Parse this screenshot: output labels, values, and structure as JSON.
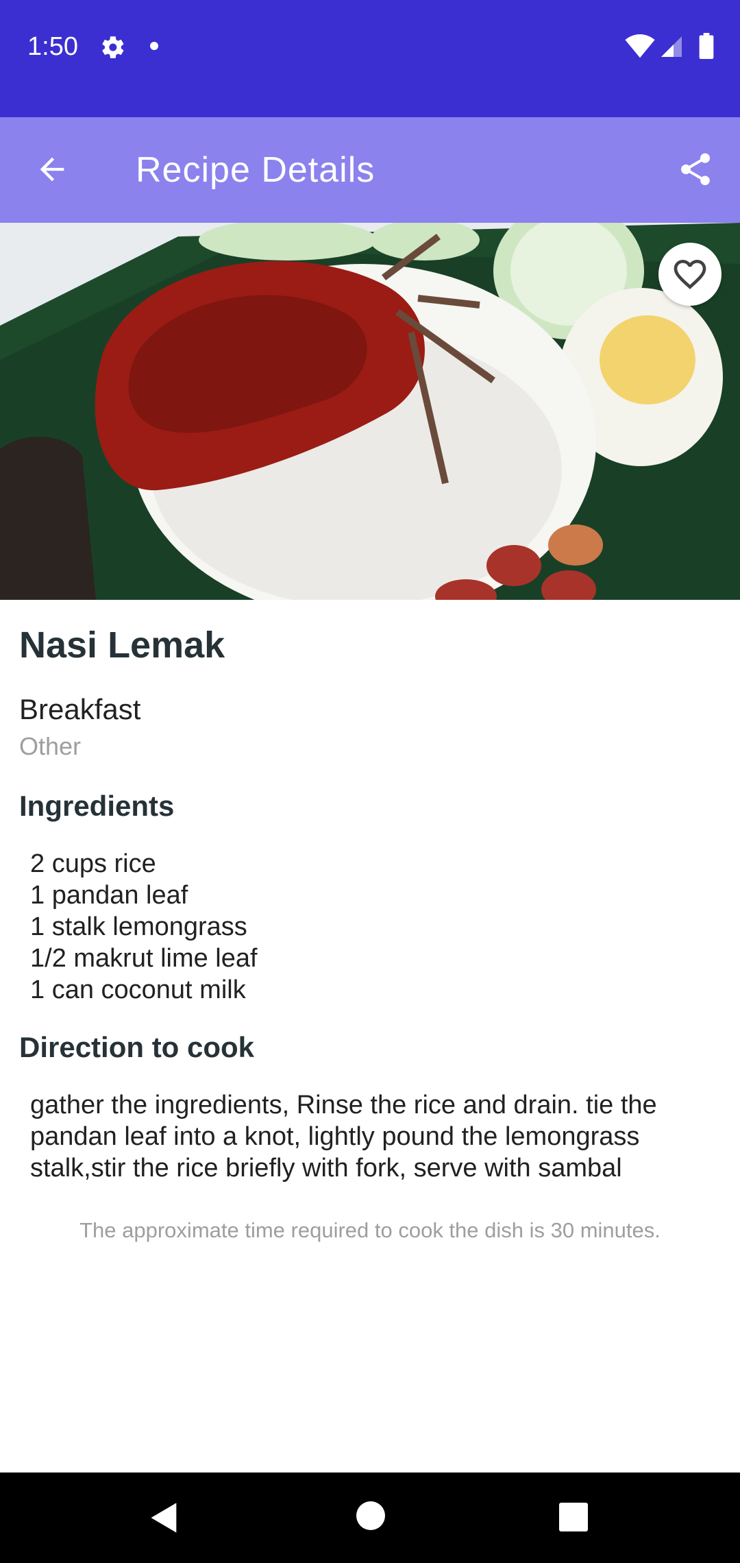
{
  "status_bar": {
    "time": "1:50",
    "icons": [
      "gear-icon",
      "notification-dot-icon",
      "wifi-icon",
      "signal-icon",
      "battery-icon"
    ]
  },
  "app_bar": {
    "title": "Recipe Details",
    "back_icon": "arrow-back-icon",
    "share_icon": "share-icon",
    "background_color": "#8b82ee"
  },
  "hero": {
    "favorite_icon": "heart-outline-icon"
  },
  "recipe": {
    "name": "Nasi Lemak",
    "category": "Breakfast",
    "subcategory": "Other",
    "ingredients_heading": "Ingredients",
    "ingredients": [
      "2 cups rice",
      "1 pandan leaf",
      "1 stalk lemongrass",
      "1/2 makrut lime leaf",
      "1 can coconut milk"
    ],
    "directions_heading": "Direction to cook",
    "directions": "gather the ingredients, Rinse the rice and drain. tie the pandan leaf into a knot, lightly pound the lemongrass stalk,stir the rice briefly with fork, serve with sambal",
    "time_note": "The approximate time required to cook the dish is 30 minutes."
  },
  "nav_bar": {
    "icons": [
      "nav-back-icon",
      "nav-home-icon",
      "nav-recents-icon"
    ]
  },
  "colors": {
    "status_bar": "#3b2fd1",
    "app_bar": "#8b82ee",
    "heading": "#263238",
    "muted": "#9e9e9e"
  }
}
